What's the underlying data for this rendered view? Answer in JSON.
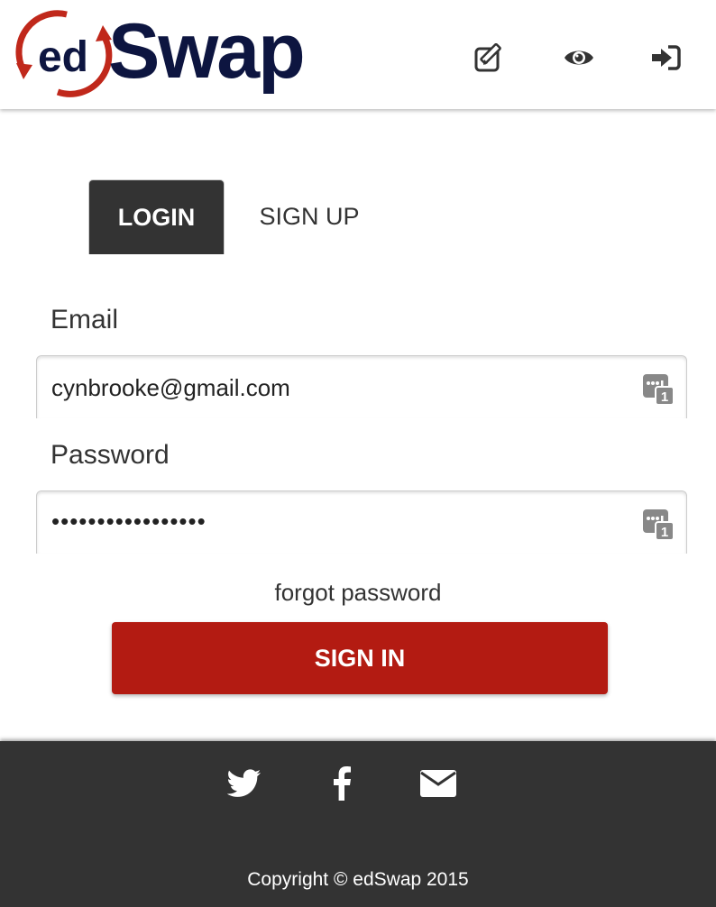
{
  "brand": {
    "logo_ed": "ed",
    "logo_swap": "Swap",
    "colors": {
      "red": "#c0281b",
      "navy": "#0d1540"
    }
  },
  "header": {
    "icons": [
      {
        "name": "edit-icon"
      },
      {
        "name": "eye-icon"
      },
      {
        "name": "sign-in-icon"
      }
    ]
  },
  "tabs": [
    {
      "label": "LOGIN",
      "active": true
    },
    {
      "label": "SIGN UP",
      "active": false
    }
  ],
  "form": {
    "email_label": "Email",
    "email_value": "cynbrooke@gmail.com",
    "password_label": "Password",
    "password_masked": "•••••••••••••••••",
    "forgot_label": "forgot password",
    "submit_label": "SIGN IN"
  },
  "footer": {
    "social": [
      {
        "name": "twitter-icon"
      },
      {
        "name": "facebook-icon"
      },
      {
        "name": "mail-icon"
      }
    ],
    "copyright": "Copyright © edSwap 2015"
  },
  "colors": {
    "tab_active_bg": "#333333",
    "button_bg": "#b31b12",
    "footer_bg": "#333333"
  }
}
